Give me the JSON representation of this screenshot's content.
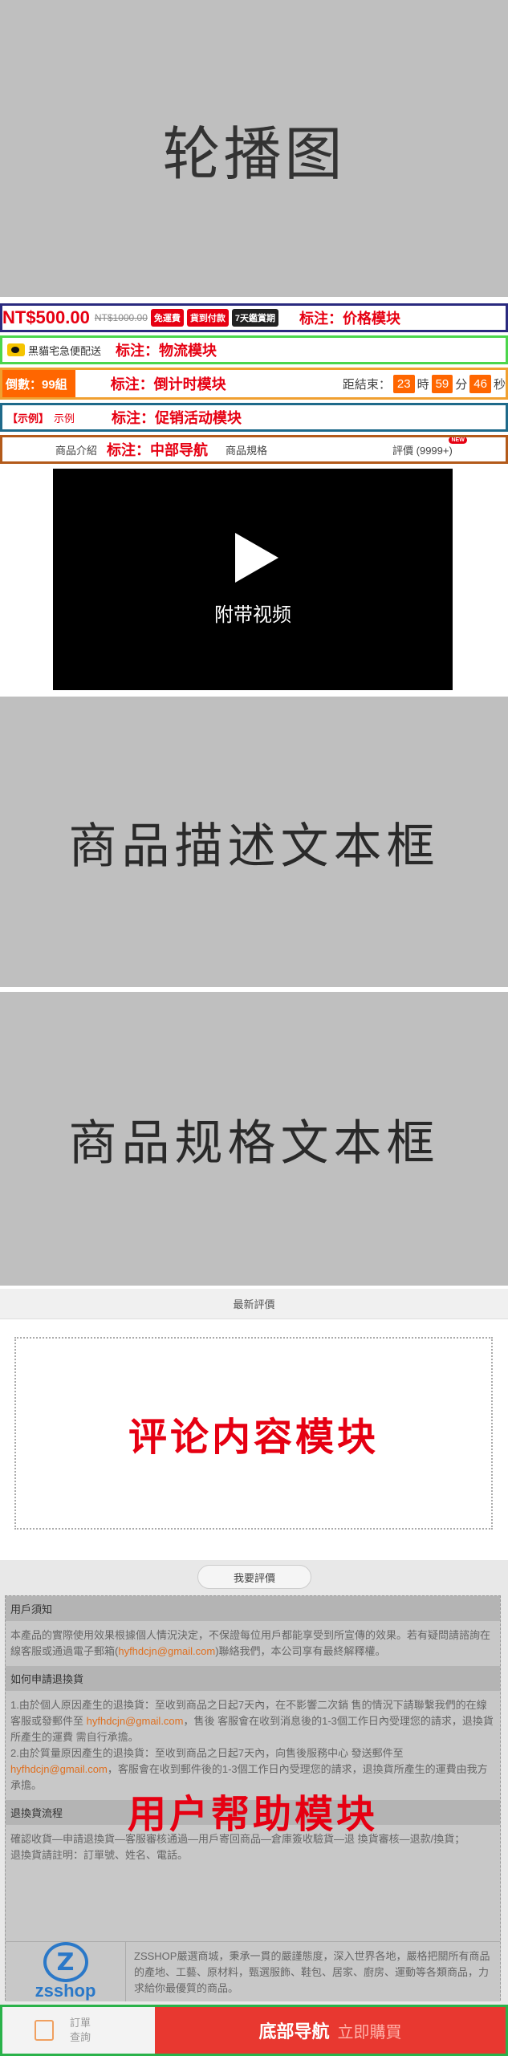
{
  "carousel": {
    "label": "轮播图"
  },
  "price": {
    "current": "NT$500.00",
    "original": "NT$1000.00",
    "tags": [
      "免運費",
      "貨到付款",
      "7天鑑賞期"
    ],
    "annotation": "标注：价格模块"
  },
  "logistics": {
    "text": "黑貓宅急便配送",
    "annotation": "标注：物流模块"
  },
  "countdown": {
    "stock": "倒數：99組",
    "annotation": "标注：倒计时模块",
    "label": "距結束：",
    "hours": "23",
    "hours_unit": "時",
    "minutes": "59",
    "minutes_unit": "分",
    "seconds": "46",
    "seconds_unit": "秒"
  },
  "promo": {
    "tag": "【示例】",
    "text": "示例",
    "annotation": "标注：促销活动模块"
  },
  "nav": {
    "intro": "商品介紹",
    "annotation": "标注：中部导航",
    "spec": "商品規格",
    "review": "評價 (9999+)",
    "new_badge": "NEW"
  },
  "video": {
    "label": "附带视频"
  },
  "description": {
    "label": "商品描述文本框"
  },
  "specs": {
    "label": "商品规格文本框"
  },
  "reviews": {
    "header": "最新評價",
    "annotation": "评论内容模块"
  },
  "help": {
    "my_review_button": "我要評價",
    "sec1_title": "用戶須知",
    "sec1_body_a": "本產品的實際使用效果根據個人情況決定，不保證每位用戶都能享受到所宣傳的效果。若有疑問請諮詢在線客服或通過電子郵箱(",
    "sec1_email": "hyfhdcjn@gmail.com",
    "sec1_body_b": ")聯絡我們，本公司享有最終解釋權。",
    "sec2_title": "如何申請退換貨",
    "sec2_body_1": "1.由於個人原因產生的退換貨：至收到商品之日起7天內，在不影響二次銷 售的情況下請聯繫我們的在線客服或發郵件至",
    "sec2_email_1": "hyfhdcjn@gmail.com",
    "sec2_body_1b": "，售後 客服會在收到消息後的1-3個工作日內受理您的請求，退換貨所產生的運費 需自行承擔。",
    "sec2_body_2": "2.由於質量原因產生的退換貨：至收到商品之日起7天內，向售後服務中心 發送郵件至",
    "sec2_email_2": "hyfhdcjn@gmail.com",
    "sec2_body_2b": "，客服會在收到郵件後的1-3個工作日內受理您的請求，退換貨所產生的運費由我方承擔。",
    "annotation": "用户帮助模块",
    "sec3_title": "退換貨流程",
    "sec3_body_1": "確認收貨—申請退換貨—客服審核通過—用戶寄回商品—倉庫簽收驗貨—退 換貨審核—退款/換貨；",
    "sec3_body_2": "退換貨請註明：訂單號、姓名、電話。",
    "logo_letter": "Z",
    "logo_text": "zsshop",
    "brand_text": "ZSSHOP嚴選商城，秉承一貫的嚴謹態度，深入世界各地，嚴格把關所有商品的產地、工藝、原材料，甄選服飾、鞋包、居家、廚房、運動等各類商品，力求給你最優質的商品。"
  },
  "bottom": {
    "order_label": "訂單查詢",
    "annotation": "底部导航",
    "buy_label": "立即購買"
  }
}
